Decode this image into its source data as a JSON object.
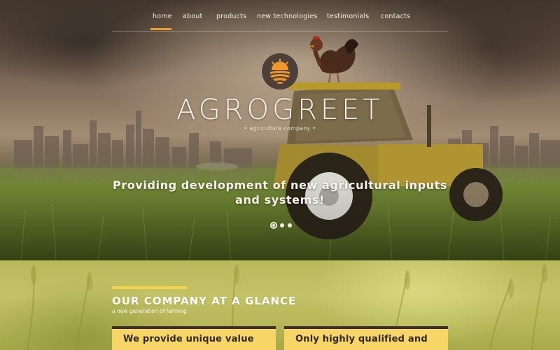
{
  "nav": {
    "items": [
      {
        "label": "home",
        "active": true
      },
      {
        "label": "about",
        "active": false
      },
      {
        "label": "products",
        "active": false
      },
      {
        "label": "new technologies",
        "active": false
      },
      {
        "label": "testimonials",
        "active": false
      },
      {
        "label": "contacts",
        "active": false
      }
    ]
  },
  "hero": {
    "brand": "AGROGREET",
    "brand_sub": "• agriculture company •",
    "tagline_line1": "Providing development of new agricultural inputs",
    "tagline_line2": "and systems!",
    "slide_count": 3,
    "active_slide": 1
  },
  "section": {
    "title": "OUR COMPANY AT A GLANCE",
    "subtitle": "a new generation of farming",
    "cards": [
      {
        "text": "We provide unique value"
      },
      {
        "text": "Only highly qualified and"
      }
    ]
  },
  "colors": {
    "accent": "#e89a2c",
    "card": "#f8d567",
    "section_bar": "#f6d24a",
    "logo_badge": "#4c4039",
    "logo_orange": "#f0962b"
  },
  "icons": {
    "logo": "sun-over-field-icon",
    "rooster": "rooster-icon",
    "tractor": "tractor-icon"
  }
}
